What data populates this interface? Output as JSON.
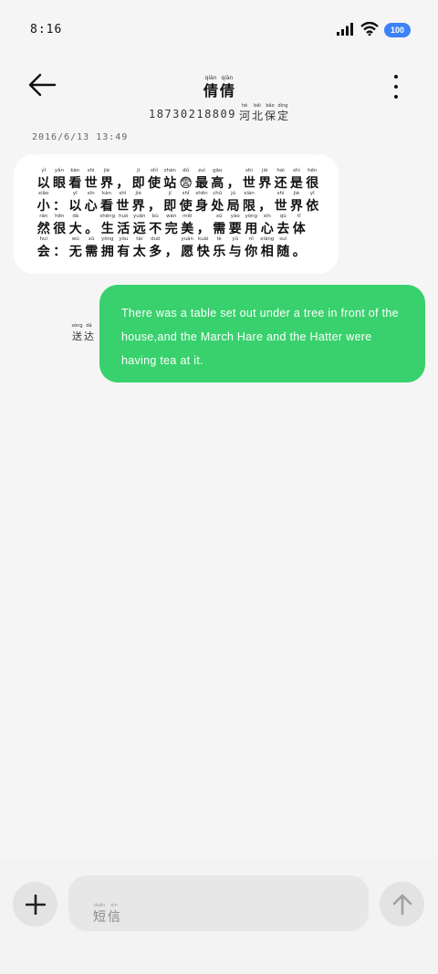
{
  "status": {
    "time": "8:16",
    "battery": "100",
    "battery_color": "#3b82f6",
    "icons": [
      "signal-icon",
      "wifi-icon",
      "battery-icon"
    ]
  },
  "header": {
    "contact_name": [
      {
        "hz": "倩",
        "py": "qiàn"
      },
      {
        "hz": "倩",
        "py": "qiàn"
      }
    ],
    "phone": "18730218809",
    "location": [
      {
        "hz": "河",
        "py": "hé"
      },
      {
        "hz": "北",
        "py": "běi"
      },
      {
        "hz": "保",
        "py": "bǎo"
      },
      {
        "hz": "定",
        "py": "dìng"
      }
    ]
  },
  "conversation": {
    "timestamp": "2016/6/13 13:49",
    "incoming_message": [
      [
        {
          "hz": "以",
          "py": "yǐ"
        },
        {
          "hz": "眼",
          "py": "yǎn"
        },
        {
          "hz": "看",
          "py": "kàn"
        },
        {
          "hz": "世",
          "py": "shì"
        },
        {
          "hz": "界",
          "py": "jiè"
        },
        {
          "hz": "，",
          "py": ""
        },
        {
          "hz": "即",
          "py": "jí"
        },
        {
          "hz": "使",
          "py": "shǐ"
        },
        {
          "hz": "站",
          "py": "zhàn"
        },
        {
          "hz": "😨",
          "py": "dǔ"
        },
        {
          "hz": "最",
          "py": "zuì"
        },
        {
          "hz": "高",
          "py": "gāo"
        },
        {
          "hz": "，",
          "py": ""
        },
        {
          "hz": "世",
          "py": "shì"
        },
        {
          "hz": "界",
          "py": "jiè"
        },
        {
          "hz": "还",
          "py": "hái"
        },
        {
          "hz": "是",
          "py": "shì"
        },
        {
          "hz": "很",
          "py": "hěn"
        }
      ],
      [
        {
          "hz": "小",
          "py": "xiǎo"
        },
        {
          "hz": "：",
          "py": ""
        },
        {
          "hz": "以",
          "py": "yǐ"
        },
        {
          "hz": "心",
          "py": "xīn"
        },
        {
          "hz": "看",
          "py": "kàn"
        },
        {
          "hz": "世",
          "py": "shì"
        },
        {
          "hz": "界",
          "py": "jiè"
        },
        {
          "hz": "，",
          "py": ""
        },
        {
          "hz": "即",
          "py": "jí"
        },
        {
          "hz": "使",
          "py": "shǐ"
        },
        {
          "hz": "身",
          "py": "shēn"
        },
        {
          "hz": "处",
          "py": "chǔ"
        },
        {
          "hz": "局",
          "py": "jú"
        },
        {
          "hz": "限",
          "py": "xiàn"
        },
        {
          "hz": "，",
          "py": ""
        },
        {
          "hz": "世",
          "py": "shì"
        },
        {
          "hz": "界",
          "py": "jiè"
        },
        {
          "hz": "依",
          "py": "yī"
        }
      ],
      [
        {
          "hz": "然",
          "py": "rán"
        },
        {
          "hz": "很",
          "py": "hěn"
        },
        {
          "hz": "大",
          "py": "dà"
        },
        {
          "hz": "。",
          "py": ""
        },
        {
          "hz": "生",
          "py": "shēng"
        },
        {
          "hz": "活",
          "py": "huó"
        },
        {
          "hz": "远",
          "py": "yuǎn"
        },
        {
          "hz": "不",
          "py": "bù"
        },
        {
          "hz": "完",
          "py": "wán"
        },
        {
          "hz": "美",
          "py": "měi"
        },
        {
          "hz": "，",
          "py": ""
        },
        {
          "hz": "需",
          "py": "xū"
        },
        {
          "hz": "要",
          "py": "yào"
        },
        {
          "hz": "用",
          "py": "yòng"
        },
        {
          "hz": "心",
          "py": "xīn"
        },
        {
          "hz": "去",
          "py": "qù"
        },
        {
          "hz": "体",
          "py": "tǐ"
        }
      ],
      [
        {
          "hz": "会",
          "py": "huì"
        },
        {
          "hz": "：",
          "py": ""
        },
        {
          "hz": "无",
          "py": "wú"
        },
        {
          "hz": "需",
          "py": "xū"
        },
        {
          "hz": "拥",
          "py": "yōng"
        },
        {
          "hz": "有",
          "py": "yǒu"
        },
        {
          "hz": "太",
          "py": "tài"
        },
        {
          "hz": "多",
          "py": "duō"
        },
        {
          "hz": "，",
          "py": ""
        },
        {
          "hz": "愿",
          "py": "yuàn"
        },
        {
          "hz": "快",
          "py": "kuài"
        },
        {
          "hz": "乐",
          "py": "lè"
        },
        {
          "hz": "与",
          "py": "yǔ"
        },
        {
          "hz": "你",
          "py": "nǐ"
        },
        {
          "hz": "相",
          "py": "xiāng"
        },
        {
          "hz": "随",
          "py": "suí"
        },
        {
          "hz": "。",
          "py": ""
        }
      ]
    ],
    "outgoing_message": "There was a table set out under a tree in front of the house,and the March Hare and the Hatter were having tea at it.",
    "outgoing_status": [
      {
        "hz": "送",
        "py": "sòng"
      },
      {
        "hz": "达",
        "py": "dá"
      }
    ],
    "outgoing_color": "#38d16d"
  },
  "composer": {
    "placeholder": [
      {
        "hz": "短",
        "py": "duǎn"
      },
      {
        "hz": "信",
        "py": "xìn"
      }
    ]
  }
}
